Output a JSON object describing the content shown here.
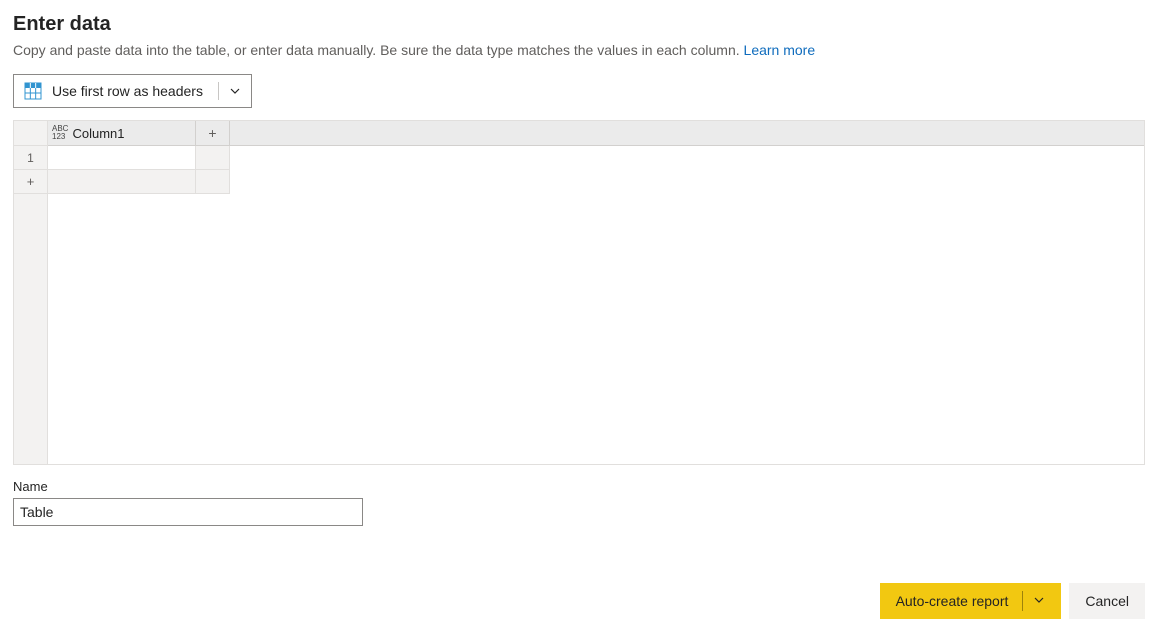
{
  "header": {
    "title": "Enter data",
    "subtitle_prefix": "Copy and paste data into the table, or enter data manually. Be sure the data type matches the values in each column. ",
    "learn_more": "Learn more"
  },
  "toolbar": {
    "use_first_row_label": "Use first row as headers"
  },
  "grid": {
    "columns": [
      "Column1"
    ],
    "type_label_top": "ABC",
    "type_label_bottom": "123",
    "rows": [
      {
        "num": "1",
        "cells": [
          ""
        ]
      }
    ],
    "add_symbol": "+"
  },
  "name": {
    "label": "Name",
    "value": "Table"
  },
  "footer": {
    "primary_label": "Auto-create report",
    "cancel_label": "Cancel"
  }
}
